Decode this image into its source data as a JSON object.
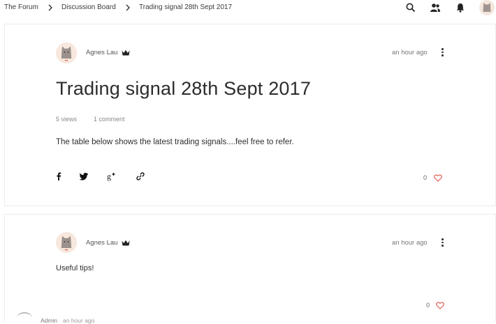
{
  "breadcrumb": {
    "items": [
      "The Forum",
      "Discussion Board",
      "Trading signal 28th Sept 2017"
    ]
  },
  "topbar_icons": [
    "search-icon",
    "members-icon",
    "notification-bell-icon",
    "user-avatar"
  ],
  "post": {
    "author": "Agnes Lau",
    "time": "an hour ago",
    "title": "Trading signal 28th Sept 2017",
    "views": "5 views",
    "comments": "1 comment",
    "body": "The table below shows the latest trading signals....feel free to refer.",
    "share_icons": [
      "facebook-icon",
      "twitter-icon",
      "google-plus-icon",
      "link-icon"
    ],
    "likes": "0"
  },
  "comment": {
    "author": "Agnes Lau",
    "time": "an hour ago",
    "body": "Useful tips!",
    "likes": "0"
  },
  "reply_preview": {
    "author": "Admin",
    "time": "an hour ago"
  },
  "colors": {
    "accent": "#e0514a",
    "text": "#32363a",
    "avatar_bg": "#f7e7dd"
  }
}
